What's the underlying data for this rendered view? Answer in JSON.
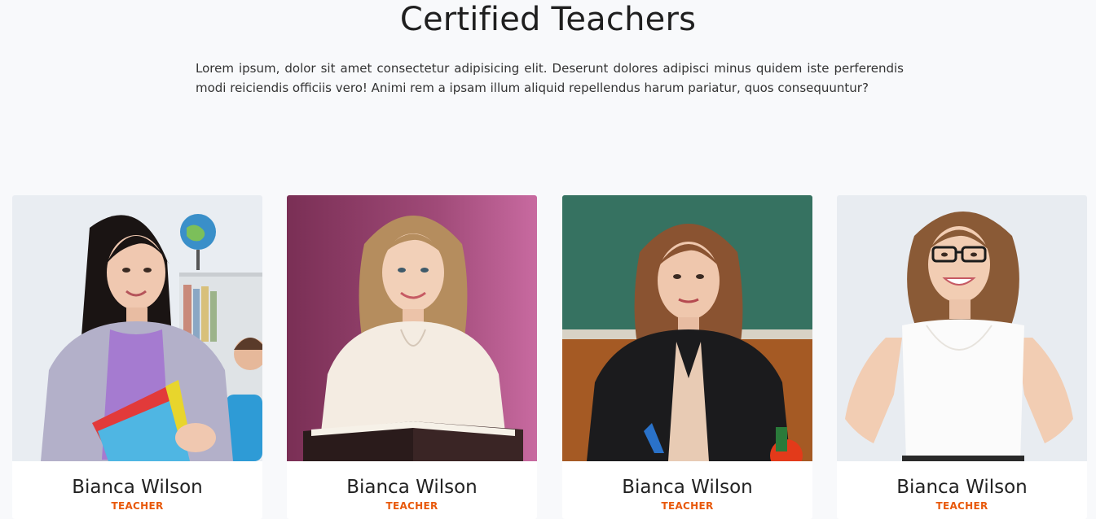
{
  "section": {
    "title": "Certified Teachers",
    "description": "Lorem ipsum, dolor sit amet consectetur adipisicing elit. Deserunt dolores adipisci minus quidem iste perferendis modi reiciendis officiis vero! Animi rem a ipsam illum aliquid repellendus harum pariatur, quos consequuntur?"
  },
  "teachers": [
    {
      "name": "Bianca Wilson",
      "role": "TEACHER",
      "photo": "teacher-1-photo"
    },
    {
      "name": "Bianca Wilson",
      "role": "TEACHER",
      "photo": "teacher-2-photo"
    },
    {
      "name": "Bianca Wilson",
      "role": "TEACHER",
      "photo": "teacher-3-photo"
    },
    {
      "name": "Bianca Wilson",
      "role": "TEACHER",
      "photo": "teacher-4-photo"
    }
  ],
  "colors": {
    "accent": "#e8590c",
    "background": "#f8f9fb",
    "card": "#ffffff",
    "text": "#222222"
  }
}
